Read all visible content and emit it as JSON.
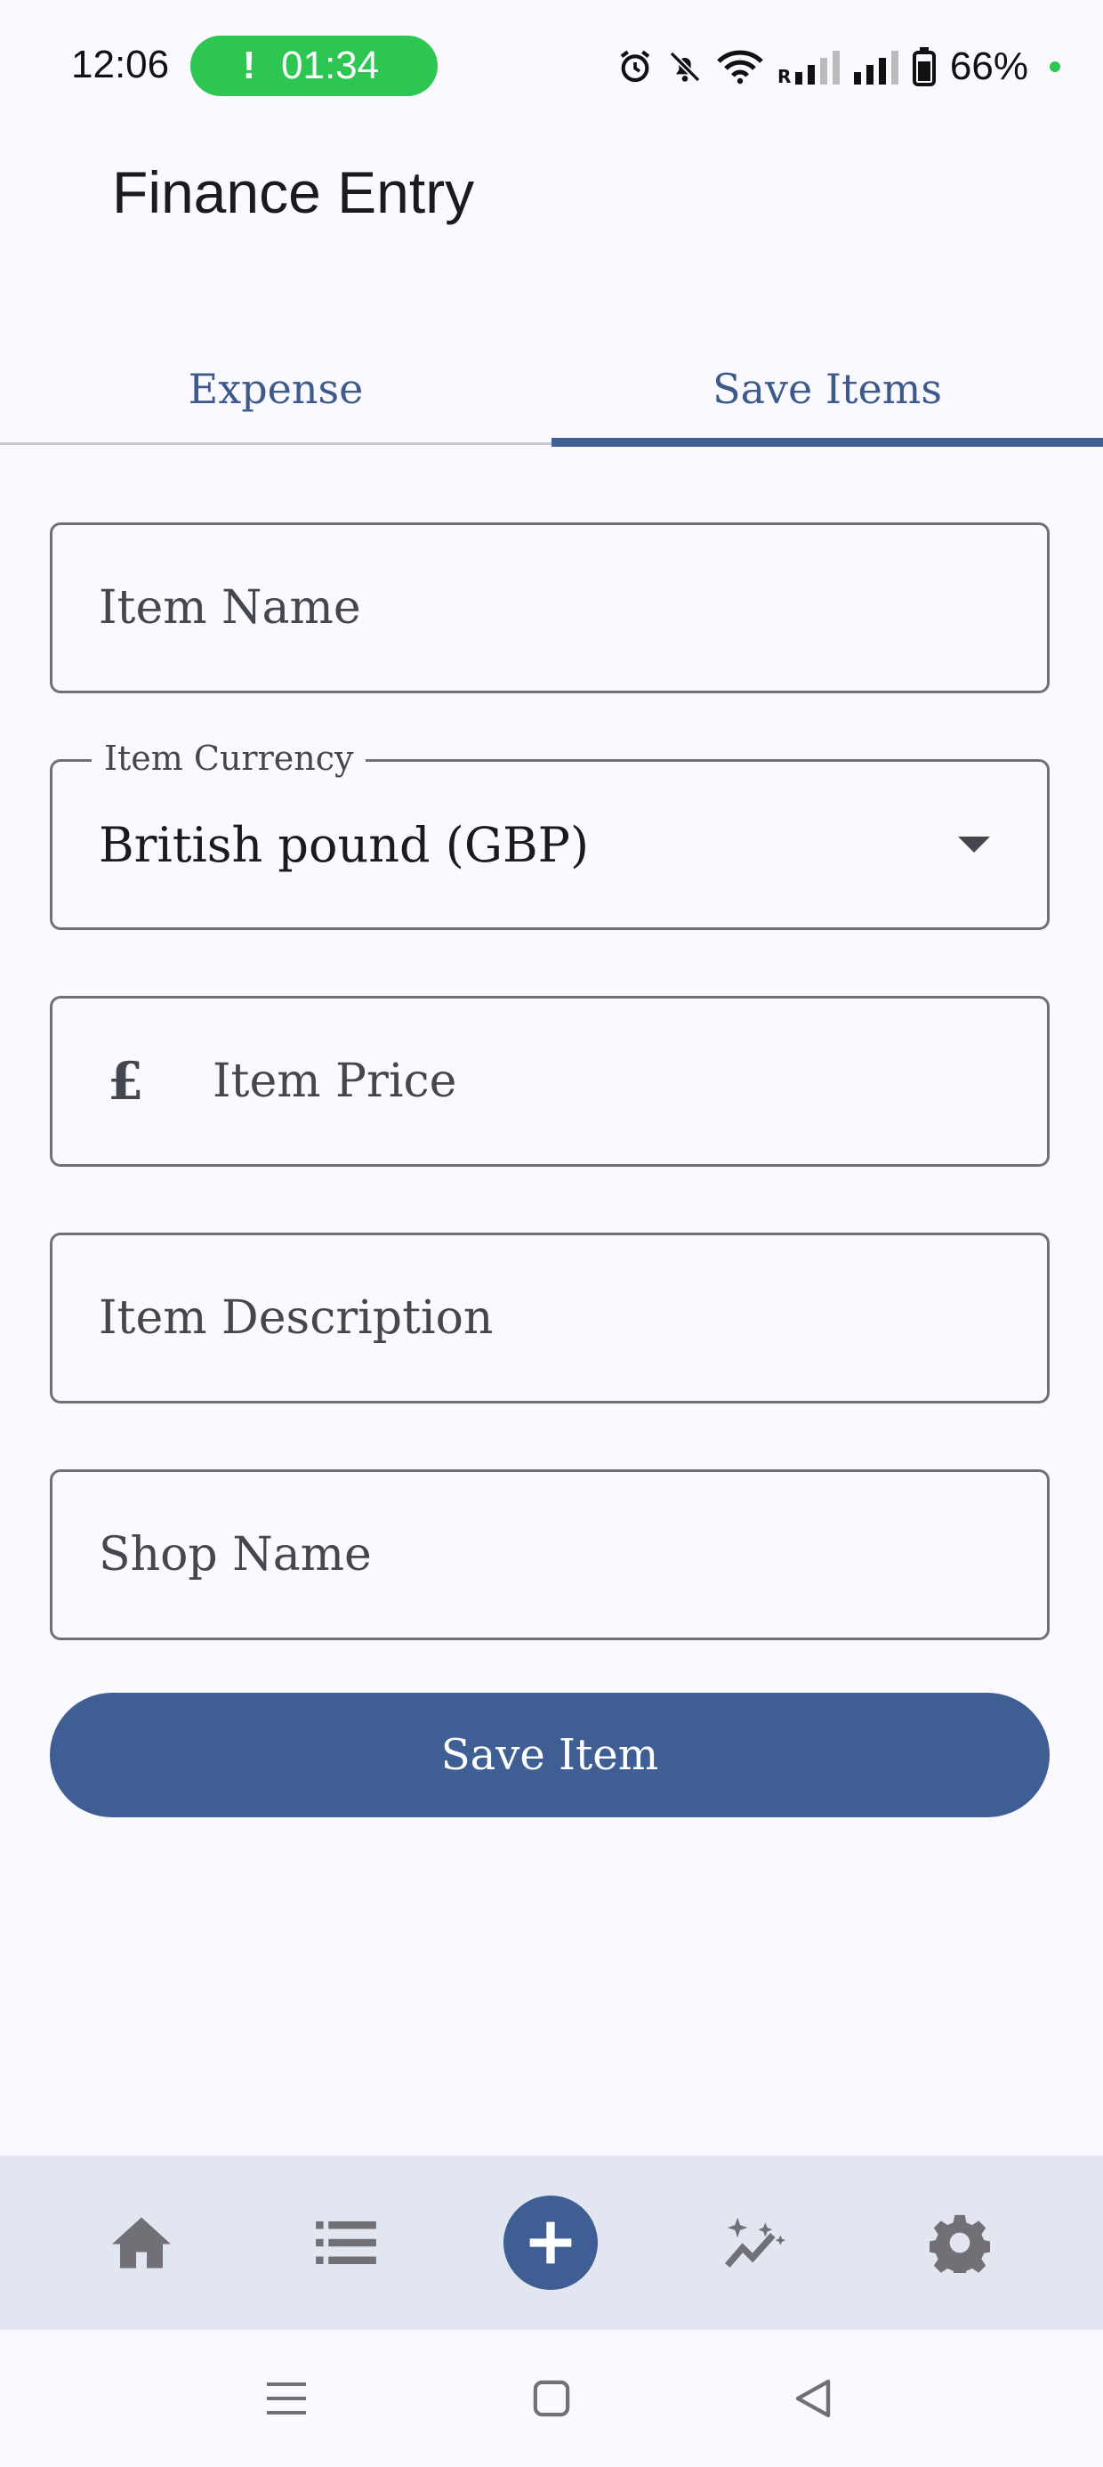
{
  "status_bar": {
    "time": "12:06",
    "call_timer": "01:34",
    "call_indicator": "!",
    "battery_percent": "66%",
    "icons": [
      "alarm-icon",
      "bell-off-icon",
      "wifi-icon",
      "signal-roaming-icon",
      "signal-icon",
      "battery-icon"
    ]
  },
  "header": {
    "title": "Finance Entry"
  },
  "tabs": [
    {
      "label": "Expense",
      "selected": false
    },
    {
      "label": "Save  Items",
      "selected": true
    }
  ],
  "form": {
    "item_name": {
      "placeholder": "Item Name"
    },
    "item_currency": {
      "label": "Item Currency",
      "value": "British pound (GBP)"
    },
    "item_price": {
      "prefix": "£",
      "placeholder": "Item Price"
    },
    "item_description": {
      "placeholder": "Item Description"
    },
    "shop_name": {
      "placeholder": "Shop Name"
    },
    "save_label": "Save Item"
  },
  "bottom_nav": {
    "items": [
      {
        "icon": "home-icon"
      },
      {
        "icon": "list-icon"
      },
      {
        "icon": "add-icon"
      },
      {
        "icon": "insights-icon"
      },
      {
        "icon": "settings-icon"
      }
    ]
  },
  "system_nav": {
    "icons": [
      "menu-icon",
      "home-square-icon",
      "back-icon"
    ]
  },
  "colors": {
    "primary": "#3f5e93",
    "background": "#f9f9ff",
    "nav_background": "#e2e6f0",
    "call_pill": "#2dc653",
    "outline": "#707076"
  }
}
